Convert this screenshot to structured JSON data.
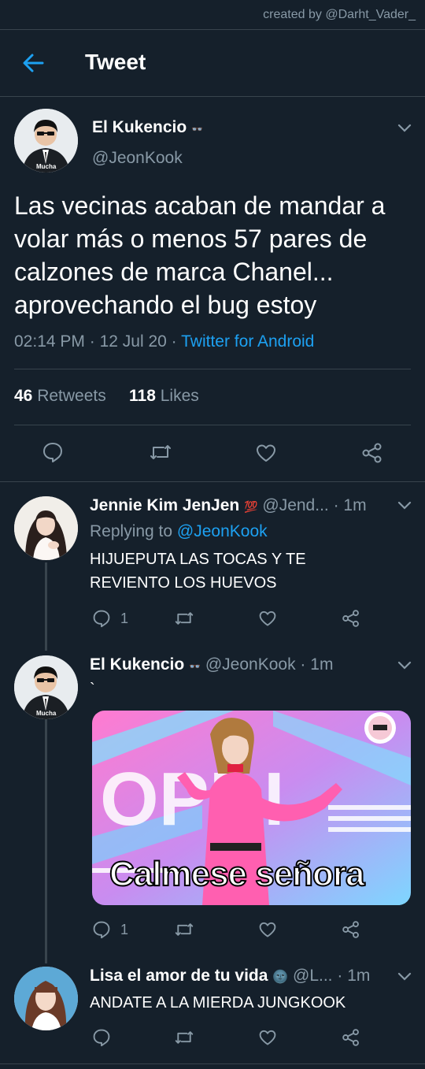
{
  "watermark": "created by @Darht_Vader_",
  "header": {
    "title": "Tweet"
  },
  "tweet": {
    "author_name": "El Kukencio",
    "author_emoji": "👓",
    "handle": "@JeonKook",
    "avatar_caption": "Mucha",
    "text": "Las vecinas acaban de mandar a volar más o menos 57 pares de calzones de marca Chanel... aprovechando el bug estoy",
    "time": "02:14 PM",
    "date": "12 Jul 20",
    "source": "Twitter for Android",
    "retweets": "46",
    "retweets_label": "Retweets",
    "likes": "118",
    "likes_label": "Likes"
  },
  "replies": [
    {
      "name": "Jennie Kim JenJen",
      "emoji": "💯",
      "handle": "@Jend...",
      "time": "1m",
      "replying_label": "Replying to",
      "replying_to": "@JeonKook",
      "text": "HIJUEPUTA LAS TOCAS Y TE REVIENTO LOS HUEVOS",
      "reply_count": "1"
    },
    {
      "name": "El Kukencio",
      "emoji": "👓",
      "handle": "@JeonKook",
      "time": "1m",
      "text": "`",
      "avatar_caption": "Mucha",
      "media_caption": "Calmese señora",
      "media_logo": "OPDI",
      "reply_count": "1"
    },
    {
      "name": "Lisa el amor de tu vida",
      "emoji": "🌚",
      "handle": "@L...",
      "time": "1m",
      "text": "ANDATE A LA MIERDA JUNGKOOK",
      "reply_count": ""
    }
  ],
  "sep": "·",
  "colors": {
    "background": "#15202b",
    "accent": "#1da1f2",
    "muted": "#8899a6",
    "divider": "#38444d"
  }
}
